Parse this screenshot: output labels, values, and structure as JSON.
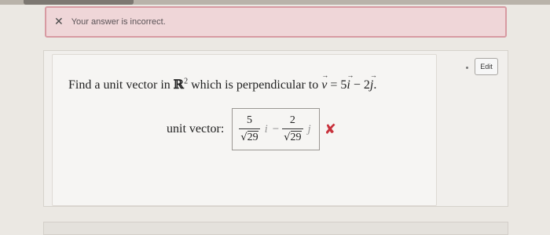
{
  "alert": {
    "icon": "close-icon",
    "message": "Your answer is incorrect."
  },
  "toolbar": {
    "edit_label": "Edit"
  },
  "question": {
    "prefix": "Find a unit vector in ",
    "space_symbol": "ℝ",
    "space_exponent": "2",
    "middle": " which is perpendicular to ",
    "vector": "v",
    "equals": " = 5",
    "unit_i": "i",
    "minus": " − 2",
    "unit_j": "j",
    "suffix": "."
  },
  "answer": {
    "label": "unit vector:",
    "term1_numerator": "5",
    "term1_radicand": "29",
    "term1_unit": "i",
    "operator": "−",
    "term2_numerator": "2",
    "term2_radicand": "29",
    "term2_unit": "j",
    "status_icon": "x-mark-icon",
    "status_color": "#c8323c"
  }
}
